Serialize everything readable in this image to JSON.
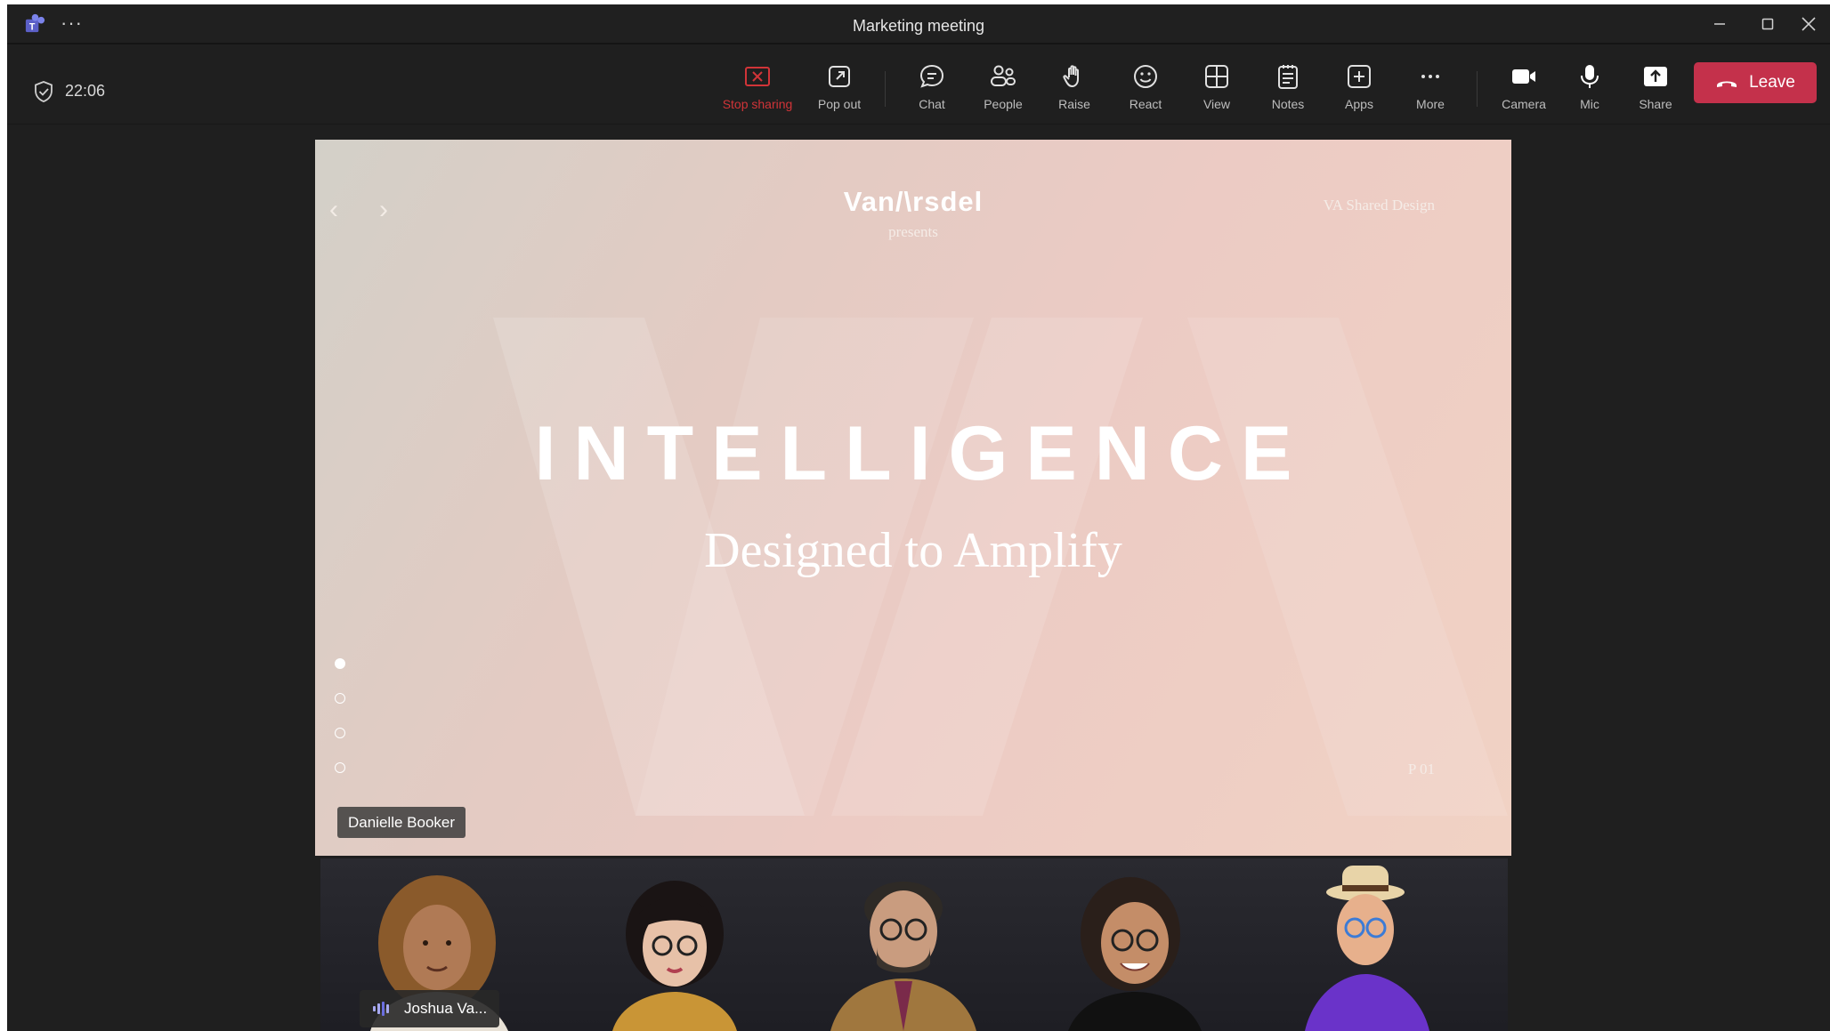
{
  "window": {
    "title": "Marketing meeting",
    "more_glyph": "···"
  },
  "toolbar": {
    "elapsed": "22:06",
    "stop_sharing": "Stop sharing",
    "pop_out": "Pop out",
    "chat": "Chat",
    "people": "People",
    "raise": "Raise",
    "react": "React",
    "view": "View",
    "notes": "Notes",
    "apps": "Apps",
    "more": "More",
    "camera": "Camera",
    "mic": "Mic",
    "share": "Share",
    "leave": "Leave"
  },
  "slide": {
    "brand": "Van/\\rsdel",
    "presents": "presents",
    "corner_label": "VA Shared Design",
    "headline": "INTELLIGENCE",
    "subtitle": "Designed to Amplify",
    "page_number": "P 01",
    "presenter": "Danielle Booker",
    "active_page_dot": 1,
    "page_dots": 4
  },
  "gallery": {
    "participant_label": "Joshua Va..."
  },
  "colors": {
    "leave": "#c4314b",
    "stop_sharing": "#d13438",
    "window_bg": "#1f1f1f"
  }
}
